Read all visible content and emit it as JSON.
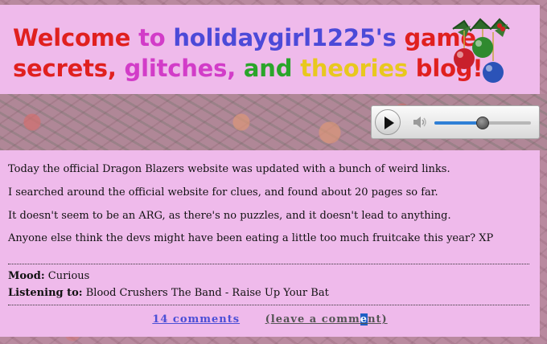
{
  "header": {
    "title_segments": [
      {
        "text": "Welcome ",
        "color": "#e0201f"
      },
      {
        "text": "to ",
        "color": "#d23cc8"
      },
      {
        "text": "holidaygirl1225's ",
        "color": "#4c4ad8"
      },
      {
        "text": "game",
        "color": "#e0201f"
      },
      {
        "text": "secrets, ",
        "color": "#e0201f"
      },
      {
        "text": "glitches, ",
        "color": "#d23cc8"
      },
      {
        "text": "and ",
        "color": "#2aa52a"
      },
      {
        "text": "theories ",
        "color": "#e8c81e"
      },
      {
        "text": "blog!",
        "color": "#e0201f"
      }
    ],
    "ornament_colors": [
      "#c8202c",
      "#2f8a2f",
      "#2b53b8"
    ]
  },
  "audio_player": {
    "play_icon": "play-icon",
    "volume_icon": "speaker-icon",
    "volume_level": 0.5
  },
  "post": {
    "paragraphs": [
      "Today the official Dragon Blazers website was updated with a bunch of weird links.",
      "I searched around the official website for clues, and found about 20 pages so far.",
      "It doesn't seem to be an ARG, as there's no puzzles, and it doesn't lead to anything.",
      "Anyone else think the devs might have been eating a little too much fruitcake this year? XP"
    ],
    "mood_label": "Mood:",
    "mood_value": " Curious",
    "listening_label": "Listening to:",
    "listening_value": " Blood Crushers The Band - Raise Up Your Bat",
    "comments_link": "14 comments",
    "leave_prefix": "(leave a comm",
    "leave_selected": "e",
    "leave_suffix": "nt)"
  }
}
